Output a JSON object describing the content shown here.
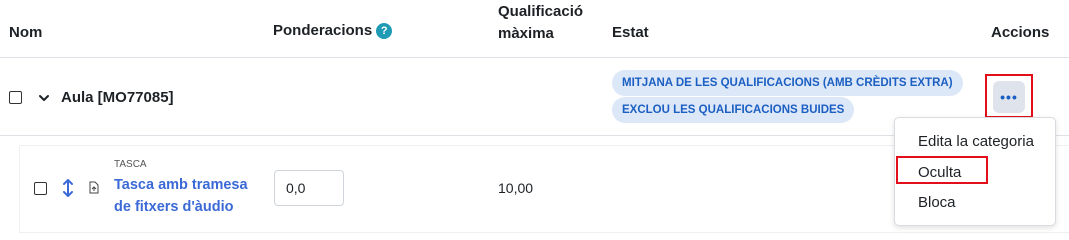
{
  "header": {
    "col_name": "Nom",
    "col_weights": "Ponderacions",
    "col_max_line1": "Qualificació",
    "col_max_line2": "màxima",
    "col_status": "Estat",
    "col_actions": "Accions",
    "help_icon_glyph": "?"
  },
  "category": {
    "name": "Aula [MO77085]",
    "badges": [
      "MITJANA DE LES QUALIFICACIONS (AMB CRÈDITS EXTRA)",
      "EXCLOU LES QUALIFICACIONS BUIDES"
    ],
    "actions_glyph": "•••"
  },
  "item": {
    "type": "TASCA",
    "name_line1": "Tasca amb tramesa",
    "name_line2": "de fitxers d'àudio",
    "weight": "0,0",
    "max_grade": "10,00"
  },
  "menu": {
    "items": [
      "Edita la categoria",
      "Oculta",
      "Bloca"
    ]
  },
  "colors": {
    "accent": "#1b5fc2",
    "badge_bg": "#dce7f8",
    "highlight": "#e20f1a",
    "help_icon": "#1f9bb5",
    "link": "#3b6ad6"
  }
}
